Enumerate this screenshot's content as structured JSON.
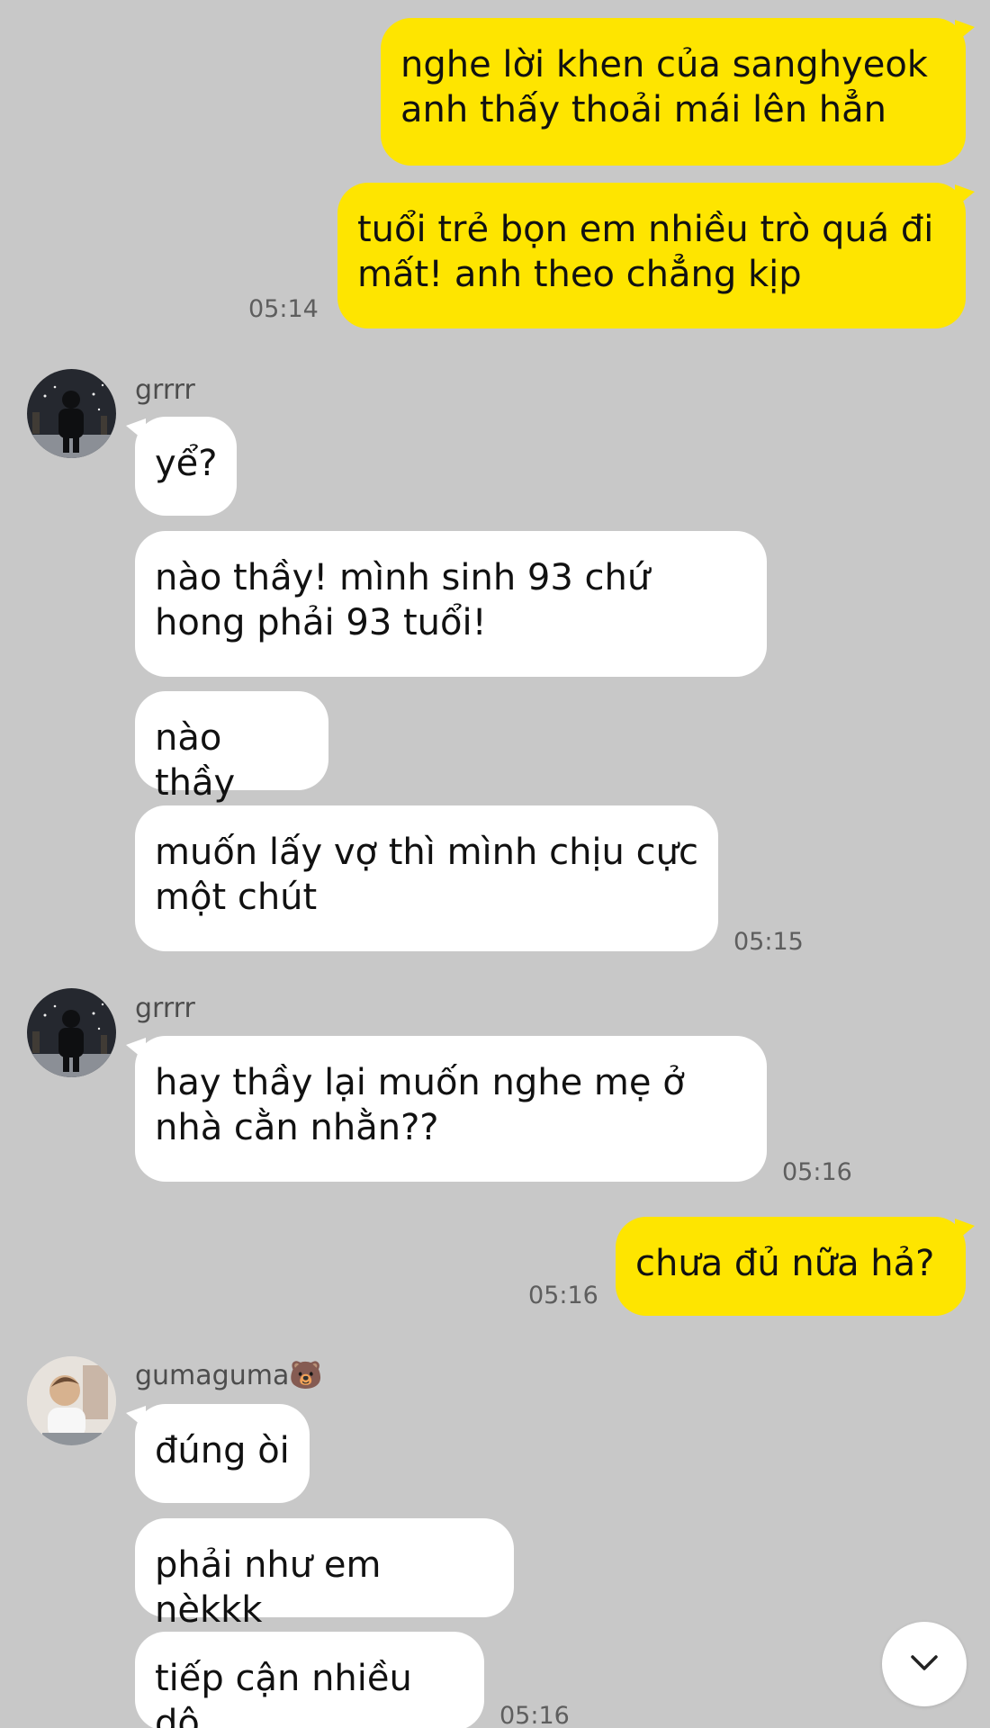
{
  "chat": {
    "messages": [
      {
        "text": "nghe lời khen của sanghyeok anh thấy thoải mái lên hẳn"
      },
      {
        "text": "tuổi trẻ bọn em nhiều trò quá đi mất! anh theo chẳng kịp",
        "time": "05:14"
      },
      {
        "sender": "grrrr",
        "text": "yể?"
      },
      {
        "text": "nào thầy! mình sinh 93 chứ hong phải 93 tuổi!"
      },
      {
        "text": "nào thầy"
      },
      {
        "text": "muốn lấy vợ thì mình chịu cực một chút",
        "time": "05:15"
      },
      {
        "sender": "grrrr",
        "text": "hay thầy lại muốn nghe mẹ ở nhà cằn nhằn??",
        "time": "05:16"
      },
      {
        "text": "chưa đủ nữa hả?",
        "time": "05:16"
      },
      {
        "sender": "gumaguma🐻",
        "text": "đúng òi"
      },
      {
        "text": "phải như em nèkkk"
      },
      {
        "text": "tiếp cận nhiều dô",
        "time": "05:16"
      }
    ]
  },
  "colors": {
    "background": "#c8c8c8",
    "outgoing_bubble": "#fee500",
    "incoming_bubble": "#ffffff"
  },
  "icons": {
    "scroll_down": "chevron-down-icon"
  }
}
